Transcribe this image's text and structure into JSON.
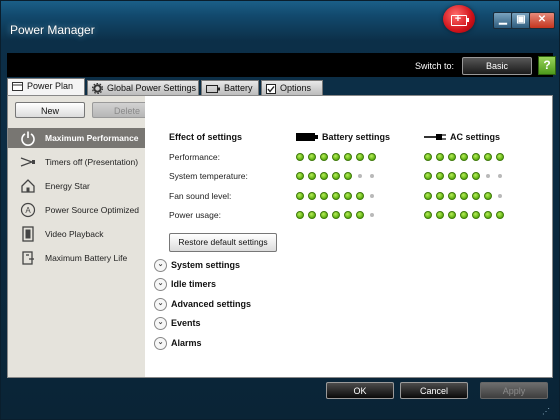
{
  "window": {
    "title": "Power Manager",
    "controls": {
      "minimize": "▁",
      "maximize": "▣",
      "close": "✕"
    }
  },
  "topbar": {
    "switch_label": "Switch to:",
    "switch_button": "Basic",
    "help_label": "?"
  },
  "tabs": [
    {
      "label": "Power Plan",
      "icon": "page-icon",
      "active": true
    },
    {
      "label": "Global Power Settings",
      "icon": "gear-icon",
      "active": false
    },
    {
      "label": "Battery",
      "icon": "battery-icon",
      "active": false
    },
    {
      "label": "Options",
      "icon": "checkbox-icon",
      "active": false
    }
  ],
  "sidebar": {
    "new_label": "New",
    "delete_label": "Delete",
    "plans": [
      {
        "label": "Maximum Performance",
        "icon": "power-icon",
        "selected": true
      },
      {
        "label": "Timers off (Presentation)",
        "icon": "presentation-icon",
        "selected": false
      },
      {
        "label": "Energy Star",
        "icon": "house-icon",
        "selected": false
      },
      {
        "label": "Power Source Optimized",
        "icon": "ac-icon",
        "selected": false
      },
      {
        "label": "Video Playback",
        "icon": "film-icon",
        "selected": false
      },
      {
        "label": "Maximum Battery Life",
        "icon": "battery-life-icon",
        "selected": false
      }
    ]
  },
  "settings": {
    "effect_header": "Effect of settings",
    "battery_header": "Battery settings",
    "ac_header": "AC settings",
    "rows": [
      {
        "label": "Performance:",
        "battery": 7,
        "ac": 7
      },
      {
        "label": "System temperature:",
        "battery": 5,
        "ac": 5
      },
      {
        "label": "Fan sound level:",
        "battery": 6,
        "ac": 6
      },
      {
        "label": "Power usage:",
        "battery": 6,
        "ac": 7
      }
    ],
    "scale_max": 7,
    "restore_label": "Restore default settings"
  },
  "sections": [
    {
      "label": "System settings"
    },
    {
      "label": "Idle timers"
    },
    {
      "label": "Advanced settings"
    },
    {
      "label": "Events"
    },
    {
      "label": "Alarms"
    }
  ],
  "footer": {
    "ok_label": "OK",
    "cancel_label": "Cancel",
    "apply_label": "Apply"
  },
  "colors": {
    "selected_plan_bg": "#787672",
    "dot_on": "#6cc21a",
    "dot_off": "#b9b9b9",
    "title_glow": "#6fb6de"
  }
}
